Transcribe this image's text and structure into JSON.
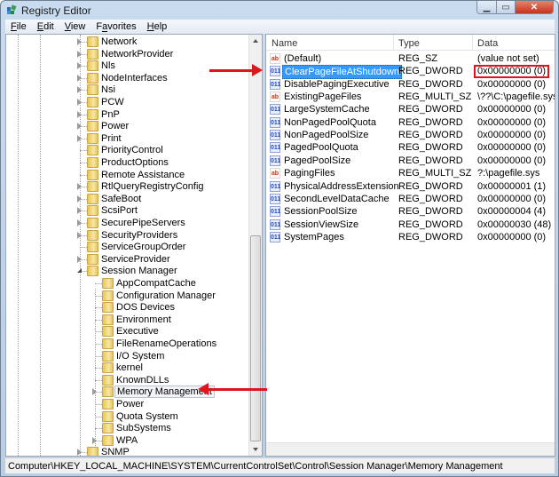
{
  "window": {
    "title": "Registry Editor",
    "app_icon": "registry-editor-icon"
  },
  "menu": [
    {
      "label": "File",
      "mnemonic": "F",
      "rest": "ile"
    },
    {
      "label": "Edit",
      "mnemonic": "E",
      "rest": "dit"
    },
    {
      "label": "View",
      "mnemonic": "V",
      "rest": "iew"
    },
    {
      "label": "Favorites",
      "mnemonic": "a",
      "pre": "F",
      "rest": "vorites"
    },
    {
      "label": "Help",
      "mnemonic": "H",
      "rest": "elp"
    }
  ],
  "tree": {
    "items": [
      {
        "label": "Network",
        "level": 1,
        "expander": "collapsed"
      },
      {
        "label": "NetworkProvider",
        "level": 1,
        "expander": "collapsed"
      },
      {
        "label": "Nls",
        "level": 1,
        "expander": "collapsed"
      },
      {
        "label": "NodeInterfaces",
        "level": 1,
        "expander": "collapsed"
      },
      {
        "label": "Nsi",
        "level": 1,
        "expander": "collapsed"
      },
      {
        "label": "PCW",
        "level": 1,
        "expander": "collapsed"
      },
      {
        "label": "PnP",
        "level": 1,
        "expander": "collapsed"
      },
      {
        "label": "Power",
        "level": 1,
        "expander": "collapsed"
      },
      {
        "label": "Print",
        "level": 1,
        "expander": "collapsed"
      },
      {
        "label": "PriorityControl",
        "level": 1,
        "expander": "none"
      },
      {
        "label": "ProductOptions",
        "level": 1,
        "expander": "none"
      },
      {
        "label": "Remote Assistance",
        "level": 1,
        "expander": "none"
      },
      {
        "label": "RtlQueryRegistryConfig",
        "level": 1,
        "expander": "collapsed"
      },
      {
        "label": "SafeBoot",
        "level": 1,
        "expander": "collapsed"
      },
      {
        "label": "ScsiPort",
        "level": 1,
        "expander": "collapsed"
      },
      {
        "label": "SecurePipeServers",
        "level": 1,
        "expander": "collapsed"
      },
      {
        "label": "SecurityProviders",
        "level": 1,
        "expander": "collapsed"
      },
      {
        "label": "ServiceGroupOrder",
        "level": 1,
        "expander": "none"
      },
      {
        "label": "ServiceProvider",
        "level": 1,
        "expander": "collapsed"
      },
      {
        "label": "Session Manager",
        "level": 1,
        "expander": "expanded"
      },
      {
        "label": "AppCompatCache",
        "level": 2,
        "expander": "none"
      },
      {
        "label": "Configuration Manager",
        "level": 2,
        "expander": "none"
      },
      {
        "label": "DOS Devices",
        "level": 2,
        "expander": "none"
      },
      {
        "label": "Environment",
        "level": 2,
        "expander": "none"
      },
      {
        "label": "Executive",
        "level": 2,
        "expander": "none"
      },
      {
        "label": "FileRenameOperations",
        "level": 2,
        "expander": "none"
      },
      {
        "label": "I/O System",
        "level": 2,
        "expander": "none"
      },
      {
        "label": "kernel",
        "level": 2,
        "expander": "none"
      },
      {
        "label": "KnownDLLs",
        "level": 2,
        "expander": "none"
      },
      {
        "label": "Memory Management",
        "level": 2,
        "expander": "collapsed",
        "selected": true
      },
      {
        "label": "Power",
        "level": 2,
        "expander": "none"
      },
      {
        "label": "Quota System",
        "level": 2,
        "expander": "none"
      },
      {
        "label": "SubSystems",
        "level": 2,
        "expander": "none"
      },
      {
        "label": "WPA",
        "level": 2,
        "expander": "collapsed"
      },
      {
        "label": "SNMP",
        "level": 1,
        "expander": "collapsed"
      }
    ]
  },
  "list": {
    "columns": {
      "name": "Name",
      "type": "Type",
      "data": "Data"
    },
    "rows": [
      {
        "name": "(Default)",
        "type": "REG_SZ",
        "data": "(value not set)",
        "icon": "string-value-icon"
      },
      {
        "name": "ClearPageFileAtShutdown",
        "type": "REG_DWORD",
        "data": "0x00000000 (0)",
        "icon": "binary-value-icon",
        "selected": true,
        "highlighted": true
      },
      {
        "name": "DisablePagingExecutive",
        "type": "REG_DWORD",
        "data": "0x00000000 (0)",
        "icon": "binary-value-icon"
      },
      {
        "name": "ExistingPageFiles",
        "type": "REG_MULTI_SZ",
        "data": "\\??\\C:\\pagefile.sys",
        "icon": "string-value-icon"
      },
      {
        "name": "LargeSystemCache",
        "type": "REG_DWORD",
        "data": "0x00000000 (0)",
        "icon": "binary-value-icon"
      },
      {
        "name": "NonPagedPoolQuota",
        "type": "REG_DWORD",
        "data": "0x00000000 (0)",
        "icon": "binary-value-icon"
      },
      {
        "name": "NonPagedPoolSize",
        "type": "REG_DWORD",
        "data": "0x00000000 (0)",
        "icon": "binary-value-icon"
      },
      {
        "name": "PagedPoolQuota",
        "type": "REG_DWORD",
        "data": "0x00000000 (0)",
        "icon": "binary-value-icon"
      },
      {
        "name": "PagedPoolSize",
        "type": "REG_DWORD",
        "data": "0x00000000 (0)",
        "icon": "binary-value-icon"
      },
      {
        "name": "PagingFiles",
        "type": "REG_MULTI_SZ",
        "data": "?:\\pagefile.sys",
        "icon": "string-value-icon"
      },
      {
        "name": "PhysicalAddressExtension",
        "type": "REG_DWORD",
        "data": "0x00000001 (1)",
        "icon": "binary-value-icon"
      },
      {
        "name": "SecondLevelDataCache",
        "type": "REG_DWORD",
        "data": "0x00000000 (0)",
        "icon": "binary-value-icon"
      },
      {
        "name": "SessionPoolSize",
        "type": "REG_DWORD",
        "data": "0x00000004 (4)",
        "icon": "binary-value-icon"
      },
      {
        "name": "SessionViewSize",
        "type": "REG_DWORD",
        "data": "0x00000030 (48)",
        "icon": "binary-value-icon"
      },
      {
        "name": "SystemPages",
        "type": "REG_DWORD",
        "data": "0x00000000 (0)",
        "icon": "binary-value-icon"
      }
    ]
  },
  "status_bar": {
    "path": "Computer\\HKEY_LOCAL_MACHINE\\SYSTEM\\CurrentControlSet\\Control\\Session Manager\\Memory Management"
  },
  "colors": {
    "selection": "#3399ff",
    "annotation": "#e0141e",
    "close_button": "#c2351b"
  }
}
